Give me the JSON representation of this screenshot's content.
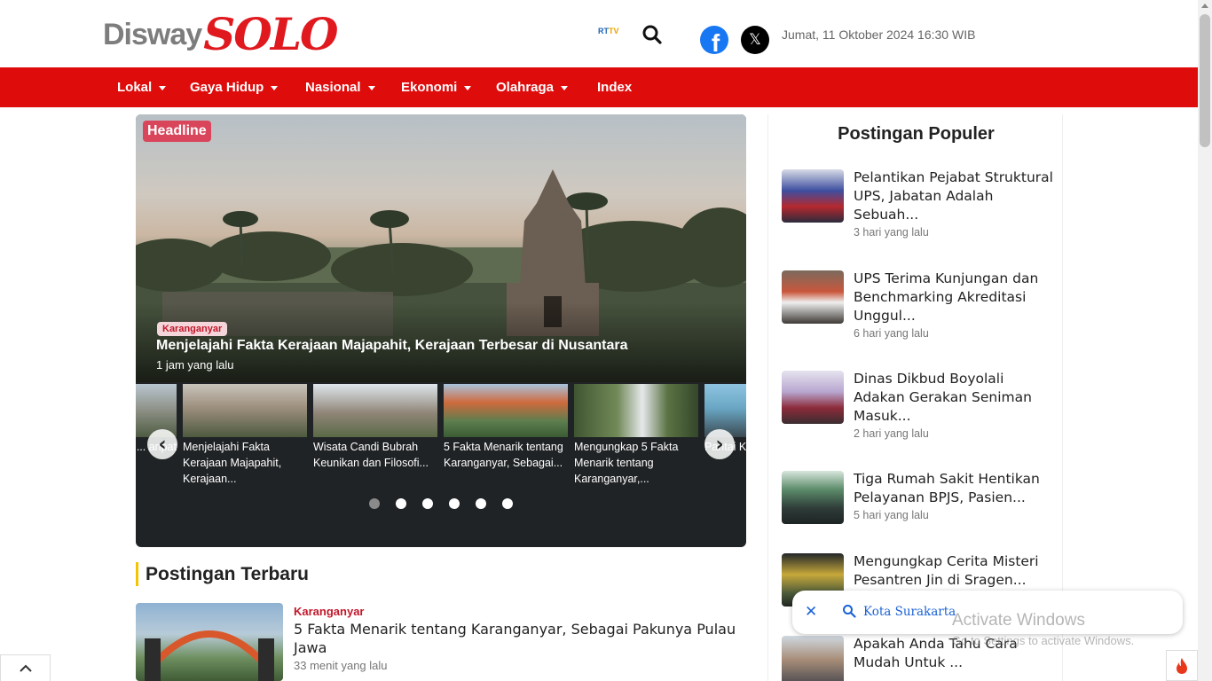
{
  "header": {
    "logo_disway": "Disway",
    "logo_solo": "SOLO",
    "rttv_label_a": "RT",
    "rttv_label_b": "TV",
    "date": "Jumat, 11 Oktober 2024 16:30 WIB",
    "icons": [
      "search-icon",
      "facebook-icon",
      "x-icon"
    ]
  },
  "nav": {
    "items": [
      {
        "label": "Lokal",
        "dropdown": true
      },
      {
        "label": "Gaya Hidup",
        "dropdown": true
      },
      {
        "label": "Nasional",
        "dropdown": true
      },
      {
        "label": "Ekonomi",
        "dropdown": true
      },
      {
        "label": "Olahraga",
        "dropdown": true
      },
      {
        "label": "Index",
        "dropdown": false
      }
    ],
    "color": "#df0c0c"
  },
  "hero": {
    "tag": "Headline",
    "category": "Karanganyar",
    "title": "Menjelajahi Fakta Kerajaan Majapahit, Kerajaan Terbesar di Nusantara",
    "time": "1 jam yang lalu",
    "thumbs": [
      {
        "caption": "... anpat"
      },
      {
        "caption": "Menjelajahi Fakta Kerajaan Majapahit, Kerajaan..."
      },
      {
        "caption": "Wisata Candi Bubrah Keunikan dan Filosofi..."
      },
      {
        "caption": "5 Fakta Menarik tentang Karanganyar, Sebagai..."
      },
      {
        "caption": "Mengungkap 5 Fakta Menarik tentang Karanganyar,..."
      },
      {
        "caption": "Pantai K... Wisata ..."
      }
    ],
    "dots": 6,
    "active_dot": 0
  },
  "latest": {
    "heading": "Postingan Terbaru",
    "items": [
      {
        "category": "Karanganyar",
        "title": "5 Fakta Menarik tentang Karanganyar, Sebagai Pakunya Pulau Jawa",
        "time": "33 menit yang lalu"
      }
    ]
  },
  "sidebar": {
    "heading": "Postingan Populer",
    "items": [
      {
        "title": "Pelantikan Pejabat Struktural UPS, Jabatan Adalah Sebuah...",
        "time": "3 hari yang lalu"
      },
      {
        "title": "UPS Terima Kunjungan dan Benchmarking Akreditasi Unggul...",
        "time": "6 hari yang lalu"
      },
      {
        "title": "Dinas Dikbud Boyolali Adakan Gerakan Seniman Masuk...",
        "time": "2 hari yang lalu"
      },
      {
        "title": "Tiga Rumah Sakit Hentikan Pelayanan BPJS, Pasien...",
        "time": "5 hari yang lalu"
      },
      {
        "title": "Mengungkap Cerita Misteri Pesantren Jin di Sragen...",
        "time": ""
      },
      {
        "title": "Apakah Anda Tahu Cara Mudah Untuk ...",
        "time": ""
      }
    ]
  },
  "location_popup": {
    "text": "Kota Surakarta"
  },
  "watermark": {
    "line1": "Activate Windows",
    "line2": "Go to Settings to activate Windows."
  }
}
